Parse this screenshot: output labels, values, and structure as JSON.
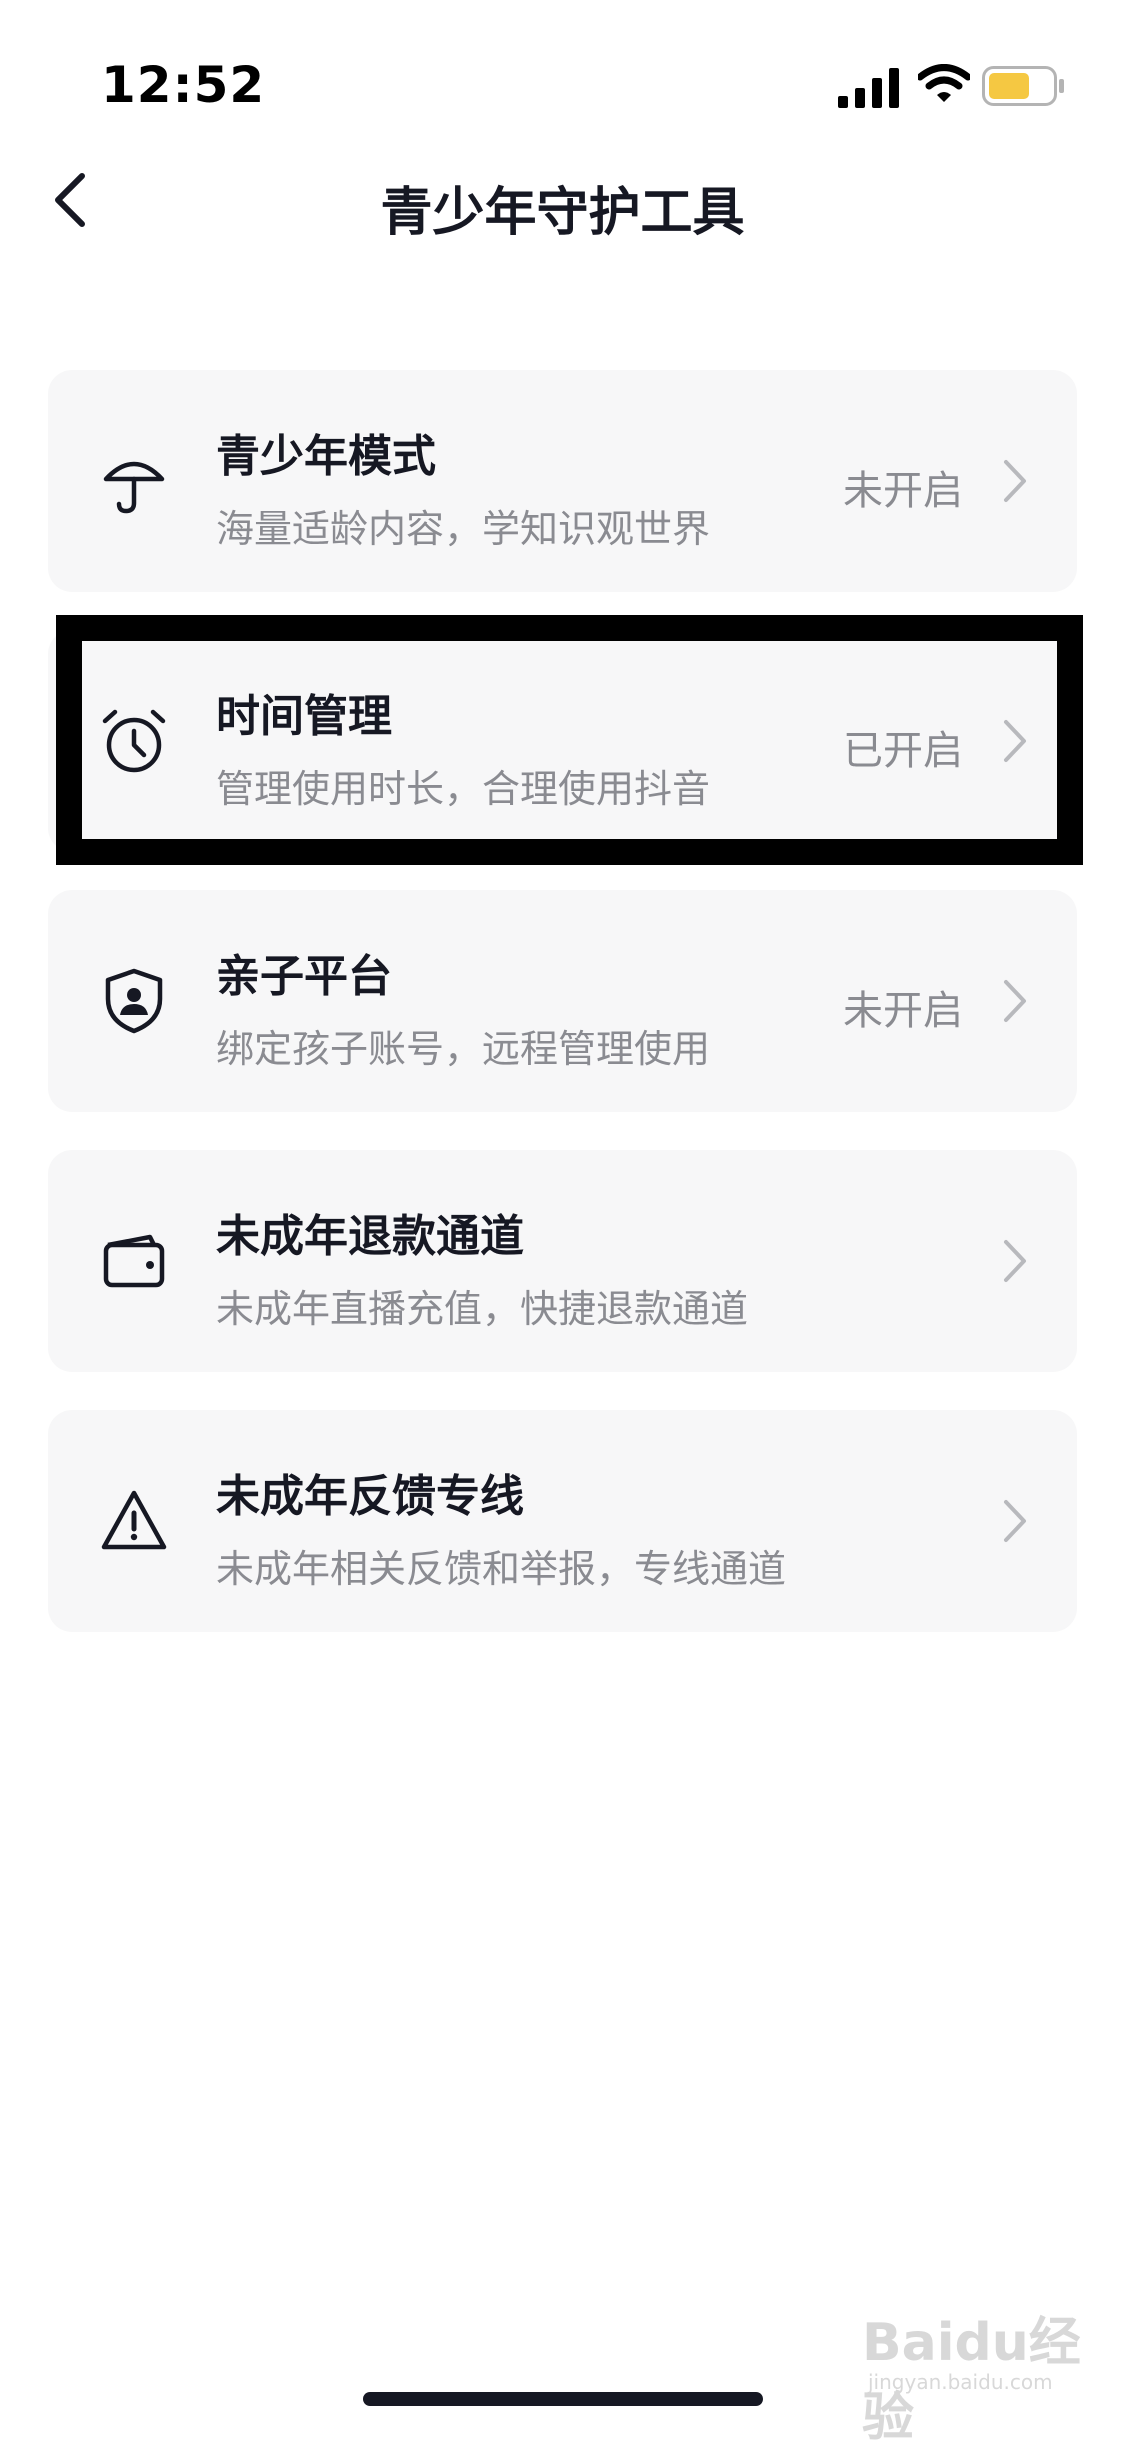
{
  "status_bar": {
    "time": "12:52",
    "battery_color": "#f5c842"
  },
  "nav": {
    "title": "青少年守护工具"
  },
  "cards": [
    {
      "title": "青少年模式",
      "subtitle": "海量适龄内容，学知识观世界",
      "status": "未开启",
      "icon": "umbrella-icon"
    },
    {
      "title": "时间管理",
      "subtitle": "管理使用时长，合理使用抖音",
      "status": "已开启",
      "icon": "alarm-clock-icon"
    },
    {
      "title": "亲子平台",
      "subtitle": "绑定孩子账号，远程管理使用",
      "status": "未开启",
      "icon": "shield-user-icon"
    },
    {
      "title": "未成年退款通道",
      "subtitle": "未成年直播充值，快捷退款通道",
      "status": "",
      "icon": "wallet-icon"
    },
    {
      "title": "未成年反馈专线",
      "subtitle": "未成年相关反馈和举报，专线通道",
      "status": "",
      "icon": "warning-icon"
    }
  ],
  "watermark": {
    "text": "Baidu经验",
    "sub": "jingyan.baidu.com"
  }
}
